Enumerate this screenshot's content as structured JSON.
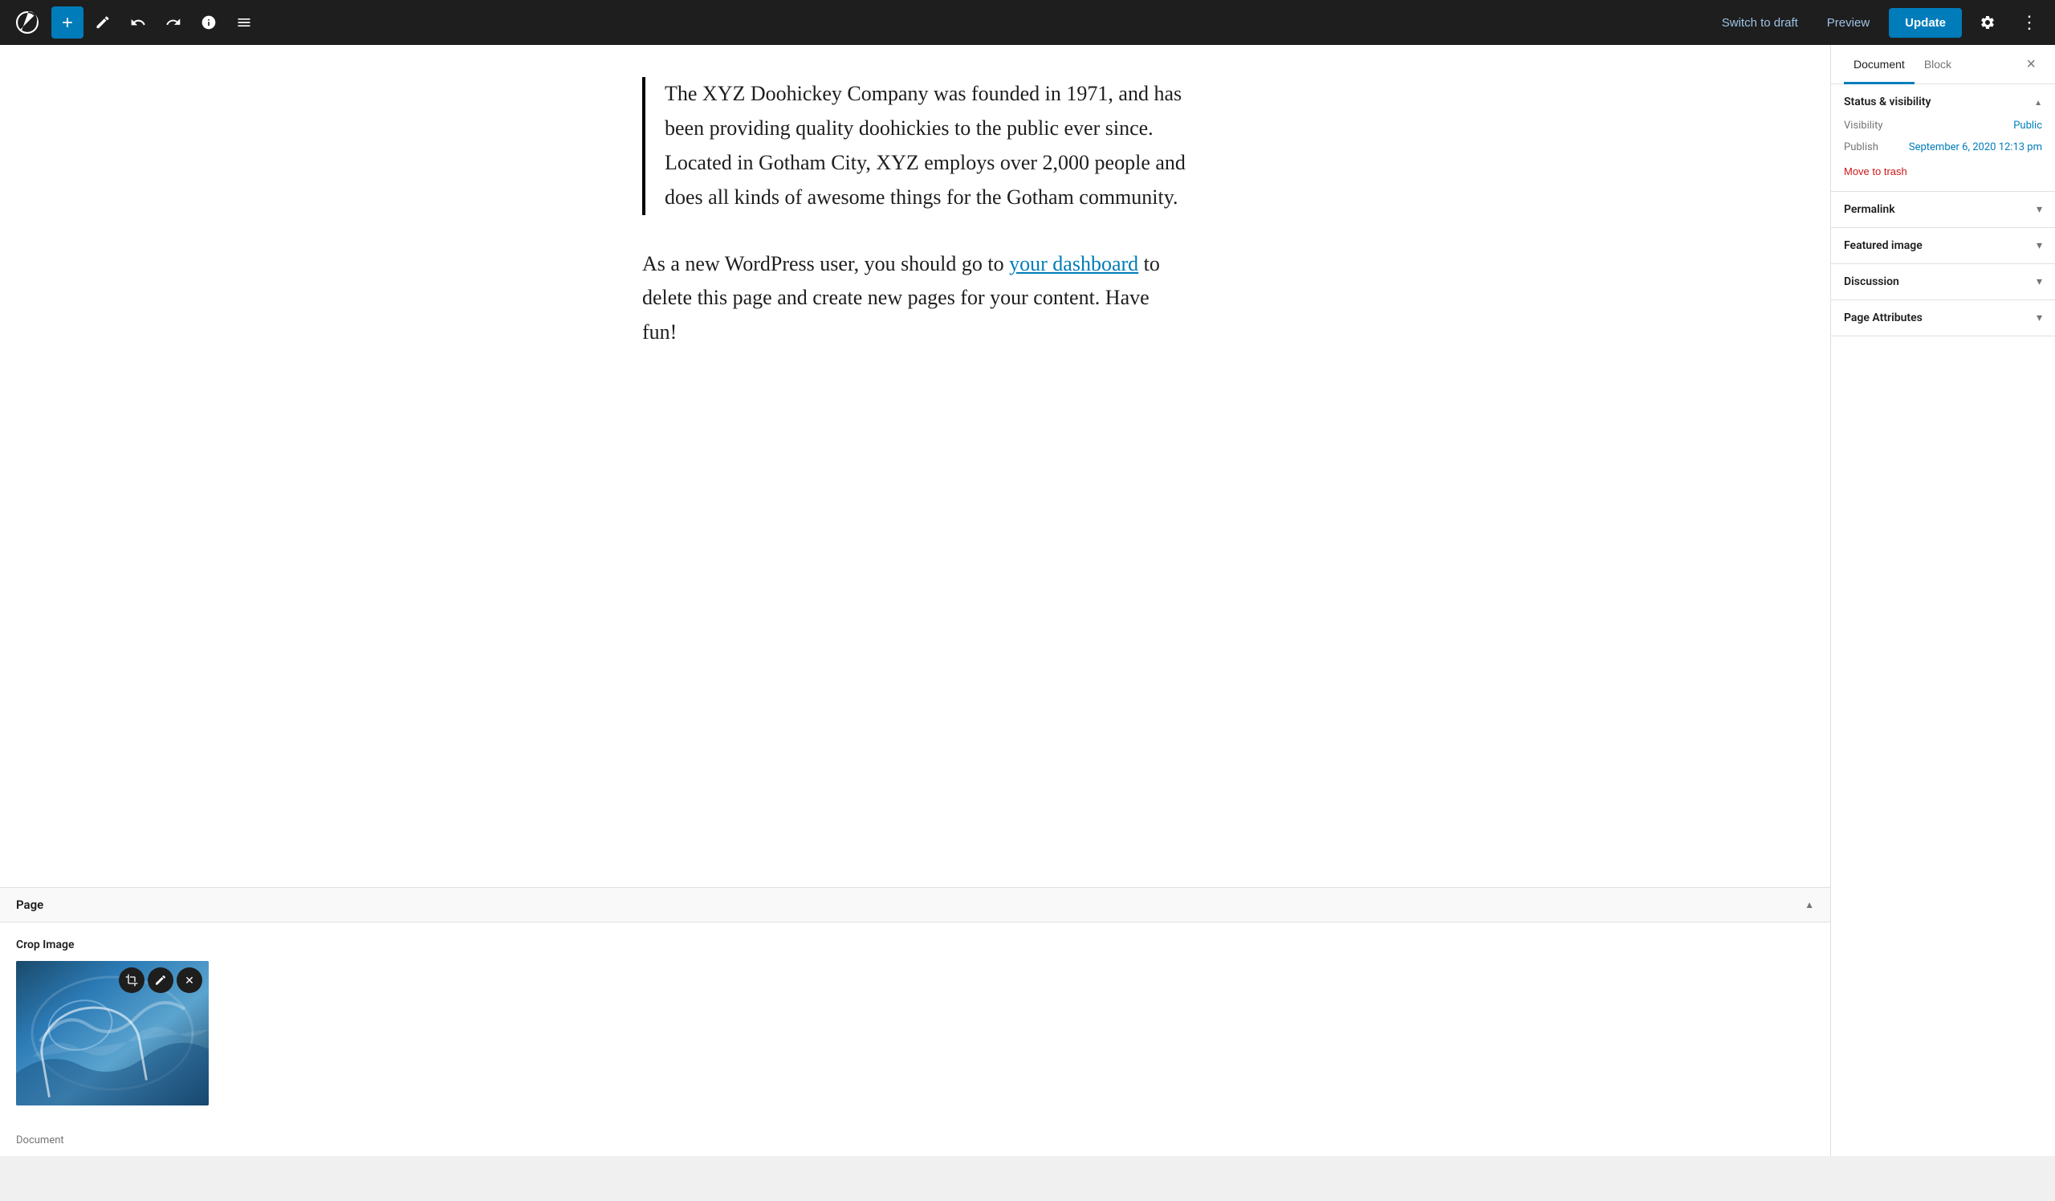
{
  "toolbar": {
    "add_label": "+",
    "edit_label": "✎",
    "undo_label": "↩",
    "redo_label": "↪",
    "info_label": "ⓘ",
    "list_label": "≡",
    "switch_draft": "Switch to draft",
    "preview": "Preview",
    "update": "Update",
    "settings_icon": "⚙",
    "more_icon": "⋮"
  },
  "editor": {
    "blockquote_text": "The XYZ Doohickey Company was founded in 1971, and has been providing quality doohickies to the public ever since. Located in Gotham City, XYZ employs over 2,000 people and does all kinds of awesome things for the Gotham community.",
    "paragraph_before_link": "As a new WordPress user, you should go to ",
    "link_text": "your dashboard",
    "paragraph_after_link": " to delete this page and create new pages for your content. Have fun!"
  },
  "bottom": {
    "page_section_title": "Page",
    "crop_image_title": "Crop Image",
    "document_label": "Document"
  },
  "sidebar": {
    "doc_tab": "Document",
    "block_tab": "Block",
    "close_label": "×",
    "status_visibility": {
      "title": "Status & visibility",
      "visibility_label": "Visibility",
      "visibility_value": "Public",
      "publish_label": "Publish",
      "publish_value": "September 6, 2020 12:13 pm",
      "move_to_trash": "Move to trash"
    },
    "permalink": {
      "title": "Permalink"
    },
    "featured_image": {
      "title": "Featured image"
    },
    "discussion": {
      "title": "Discussion"
    },
    "page_attributes": {
      "title": "Page Attributes"
    }
  }
}
